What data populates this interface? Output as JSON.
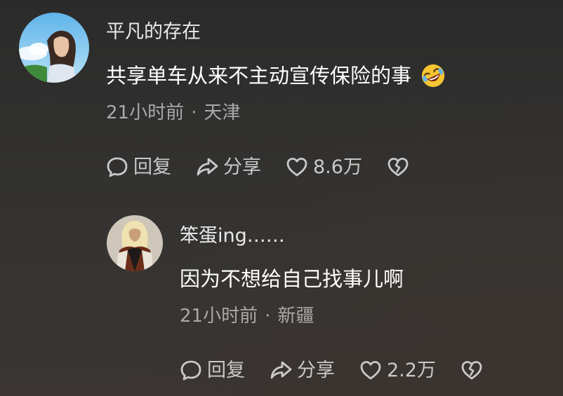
{
  "comments": [
    {
      "username": "平凡的存在",
      "text": "共享单车从来不主动宣传保险的事",
      "emoji": "rofl-emoji",
      "time": "21小时前",
      "location": "天津",
      "reply_label": "回复",
      "share_label": "分享",
      "like_count": "8.6万"
    },
    {
      "username": "笨蛋ing……",
      "text": "因为不想给自己找事儿啊",
      "time": "21小时前",
      "location": "新疆",
      "reply_label": "回复",
      "share_label": "分享",
      "like_count": "2.2万"
    }
  ],
  "separator": "·",
  "icons": {
    "reply": "speech-bubble-icon",
    "share": "share-arrow-icon",
    "like": "heart-outline-icon",
    "dislike": "broken-heart-icon"
  },
  "colors": {
    "background": "#2f2f2e",
    "text_primary": "#ffffff",
    "text_secondary": "#a9a9a9",
    "action_text": "#c9c9c9"
  }
}
